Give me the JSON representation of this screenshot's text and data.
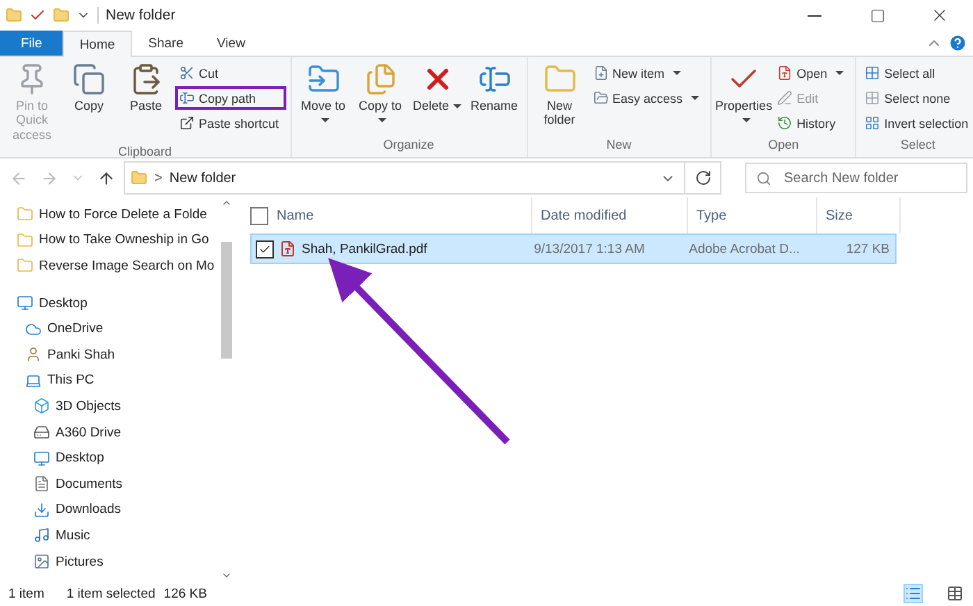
{
  "window": {
    "title": "New folder"
  },
  "tabs": [
    {
      "label": "File",
      "kind": "file",
      "selected": false
    },
    {
      "label": "Home",
      "kind": "tab",
      "selected": true
    },
    {
      "label": "Share",
      "kind": "tab",
      "selected": false
    },
    {
      "label": "View",
      "kind": "tab",
      "selected": false
    }
  ],
  "ribbon": [
    {
      "name": "Clipboard",
      "large": [
        {
          "label": "Pin to Quick access",
          "disabled": true,
          "dropdown": false
        },
        {
          "label": "Copy",
          "disabled": false,
          "dropdown": false
        },
        {
          "label": "Paste",
          "disabled": false,
          "dropdown": false
        }
      ],
      "small": [
        {
          "label": "Cut",
          "disabled": false,
          "dropdown": false,
          "highlighted": false
        },
        {
          "label": "Copy path",
          "disabled": false,
          "dropdown": false,
          "highlighted": true
        },
        {
          "label": "Paste shortcut",
          "disabled": false,
          "dropdown": false,
          "highlighted": false
        }
      ]
    },
    {
      "name": "Organize",
      "large": [
        {
          "label": "Move to",
          "disabled": false,
          "dropdown": true
        },
        {
          "label": "Copy to",
          "disabled": false,
          "dropdown": true
        },
        {
          "label": "Delete",
          "disabled": false,
          "dropdown": true
        },
        {
          "label": "Rename",
          "disabled": false,
          "dropdown": false
        }
      ]
    },
    {
      "name": "New",
      "large": [
        {
          "label": "New folder",
          "disabled": false,
          "dropdown": false
        }
      ],
      "small": [
        {
          "label": "New item",
          "disabled": false,
          "dropdown": true,
          "highlighted": false
        },
        {
          "label": "Easy access",
          "disabled": false,
          "dropdown": true,
          "highlighted": false
        }
      ]
    },
    {
      "name": "Open",
      "large": [
        {
          "label": "Properties",
          "disabled": false,
          "dropdown": true
        }
      ],
      "small": [
        {
          "label": "Open",
          "disabled": false,
          "dropdown": true,
          "highlighted": false
        },
        {
          "label": "Edit",
          "disabled": true,
          "dropdown": false,
          "highlighted": false
        },
        {
          "label": "History",
          "disabled": false,
          "dropdown": false,
          "highlighted": false
        }
      ]
    },
    {
      "name": "Select",
      "small": [
        {
          "label": "Select all",
          "disabled": false,
          "dropdown": false,
          "highlighted": false
        },
        {
          "label": "Select none",
          "disabled": false,
          "dropdown": false,
          "highlighted": false
        },
        {
          "label": "Invert selection",
          "disabled": false,
          "dropdown": false,
          "highlighted": false
        }
      ]
    }
  ],
  "address": {
    "separator": ">",
    "path": "New folder"
  },
  "search": {
    "placeholder": "Search New folder"
  },
  "sidebar": {
    "items": [
      {
        "label": "How to Force Delete a Folde"
      },
      {
        "label": "How to Take Owneship in Go"
      },
      {
        "label": "Reverse Image Search on Mo"
      },
      {
        "label": "Desktop",
        "children": [
          {
            "label": "OneDrive"
          },
          {
            "label": "Panki Shah"
          },
          {
            "label": "This PC",
            "children": [
              {
                "label": "3D Objects"
              },
              {
                "label": "A360 Drive"
              },
              {
                "label": "Desktop"
              },
              {
                "label": "Documents"
              },
              {
                "label": "Downloads"
              },
              {
                "label": "Music"
              },
              {
                "label": "Pictures"
              }
            ]
          }
        ]
      }
    ]
  },
  "table": {
    "header_checked": false,
    "columns": [
      "Name",
      "Date modified",
      "Type",
      "Size"
    ],
    "rows": [
      {
        "cells": [
          "Shah, PankilGrad.pdf",
          "9/13/2017 1:13 AM",
          "Adobe Acrobat D...",
          "127 KB"
        ],
        "selected": true,
        "checked": true
      }
    ]
  },
  "status_bar": {
    "count": "1 item",
    "selection": "1 item selected",
    "size": "126 KB",
    "views": [
      {
        "kind": "details",
        "selected": true
      },
      {
        "kind": "tiles",
        "selected": false
      }
    ]
  }
}
